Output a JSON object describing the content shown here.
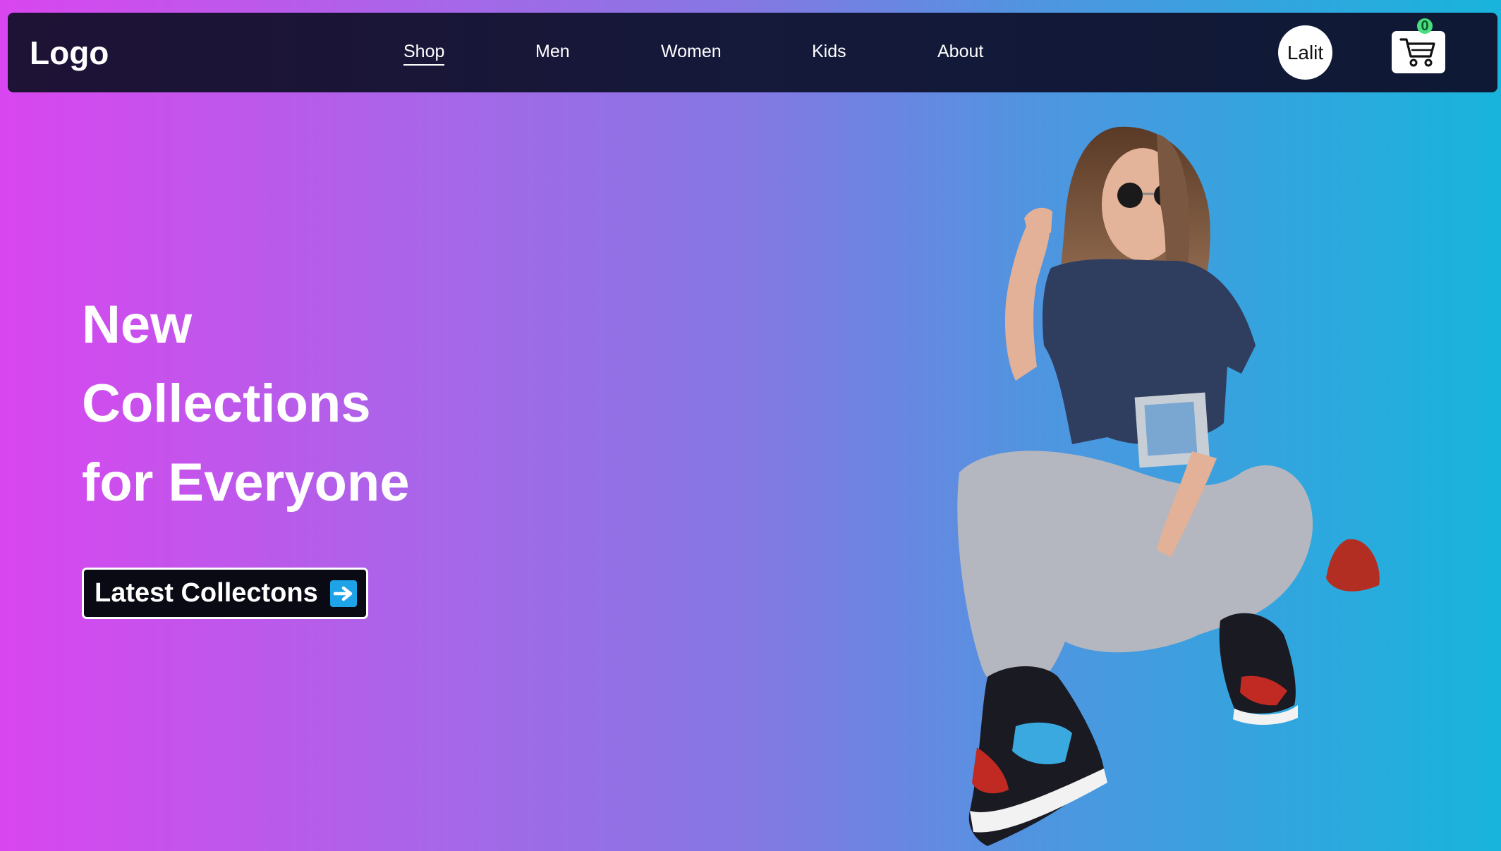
{
  "nav": {
    "logo": "Logo",
    "links": [
      "Shop",
      "Men",
      "Women",
      "Kids",
      "About"
    ],
    "active": "Shop",
    "user_label": "Lalit",
    "cart_count": "0",
    "cart_icon": "shopping-cart-icon"
  },
  "hero": {
    "title_lines": [
      "New",
      "Collections",
      "for Everyone"
    ],
    "cta_label": "Latest Collectons",
    "cta_icon": "right-arrow-icon",
    "image": "model-photo"
  },
  "colors": {
    "gradient_start": "#d946ef",
    "gradient_end": "#18b4dc",
    "navbar": "#15193a",
    "cart_badge": "#4ade80",
    "arrow_badge": "#1fa3e8"
  }
}
